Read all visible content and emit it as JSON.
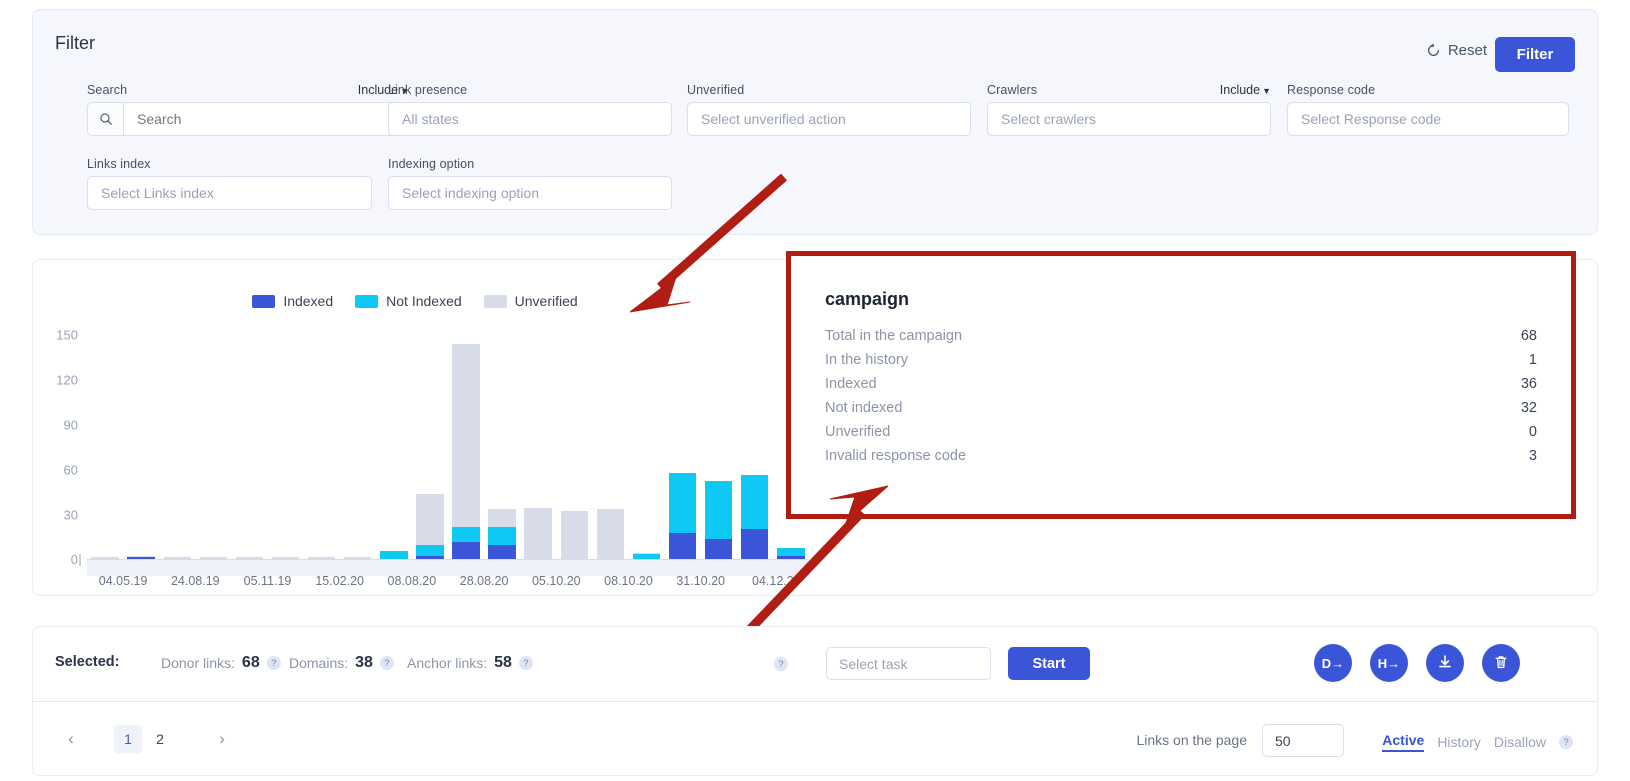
{
  "filter": {
    "title": "Filter",
    "reset_label": "Reset",
    "filter_label": "Filter",
    "accent": "#3b55d9",
    "fields": [
      {
        "label": "Search",
        "include": "Include",
        "placeholder": "Search",
        "type": "search"
      },
      {
        "label": "Link presence",
        "include": "",
        "placeholder": "All states",
        "type": "select"
      },
      {
        "label": "Unverified",
        "include": "",
        "placeholder": "Select unverified action",
        "type": "select"
      },
      {
        "label": "Crawlers",
        "include": "Include",
        "placeholder": "Select crawlers",
        "type": "select"
      },
      {
        "label": "Response code",
        "include": "",
        "placeholder": "Select Response code",
        "type": "select"
      },
      {
        "label": "Links index",
        "include": "",
        "placeholder": "Select Links index",
        "type": "select"
      },
      {
        "label": "Indexing option",
        "include": "",
        "placeholder": "Select indexing option",
        "type": "select"
      }
    ]
  },
  "chart_data": {
    "type": "bar",
    "stacked": true,
    "title": "",
    "xlabel": "",
    "ylabel": "",
    "ylim": [
      0,
      150
    ],
    "yticks": [
      150,
      120,
      90,
      60,
      30,
      0
    ],
    "grid": false,
    "legend_position": "top-center",
    "colors": {
      "Indexed": "#3b55d9",
      "Not Indexed": "#0fc9f4",
      "Unverified": "#d7dce8"
    },
    "legend": [
      "Indexed",
      "Not Indexed",
      "Unverified"
    ],
    "categories": [
      "04.05.19",
      "",
      "24.08.19",
      "",
      "05.11.19",
      "",
      "15.02.20",
      "",
      "08.08.20",
      "",
      "28.08.20",
      "",
      "05.10.20",
      "",
      "08.10.20",
      "",
      "31.10.20",
      "",
      "04.12.2",
      ""
    ],
    "xtick_labels": [
      "04.05.19",
      "24.08.19",
      "05.11.19",
      "15.02.20",
      "08.08.20",
      "28.08.20",
      "05.10.20",
      "08.10.20",
      "31.10.20",
      "04.12.2"
    ],
    "series": [
      {
        "name": "Indexed",
        "values": [
          1,
          2,
          1,
          1,
          1,
          1,
          1,
          1,
          0,
          3,
          12,
          10,
          1,
          1,
          1,
          1,
          18,
          14,
          21,
          3
        ]
      },
      {
        "name": "Not Indexed",
        "values": [
          0,
          0,
          0,
          0,
          0,
          0,
          0,
          0,
          6,
          7,
          10,
          12,
          0,
          0,
          0,
          3,
          40,
          39,
          36,
          5
        ]
      },
      {
        "name": "Unverified",
        "values": [
          1,
          1,
          1,
          1,
          1,
          1,
          1,
          1,
          0,
          34,
          122,
          12,
          34,
          32,
          33,
          1,
          0,
          0,
          0,
          0
        ]
      }
    ]
  },
  "campaign": {
    "title": "campaign",
    "rows": [
      {
        "label": "Total in the campaign",
        "value": "68"
      },
      {
        "label": "In the history",
        "value": "1"
      },
      {
        "label": "Indexed",
        "value": "36"
      },
      {
        "label": "Not indexed",
        "value": "32"
      },
      {
        "label": "Unverified",
        "value": "0"
      },
      {
        "label": "Invalid response code",
        "value": "3"
      }
    ],
    "highlight_color": "#b01d12"
  },
  "toolbar": {
    "selected_label": "Selected:",
    "stats": [
      {
        "key": "Donor links:",
        "value": "68"
      },
      {
        "key": "Domains:",
        "value": "38"
      },
      {
        "key": "Anchor links:",
        "value": "58"
      }
    ],
    "help_glyph": "?",
    "task_placeholder": "Select task",
    "start_label": "Start",
    "round_buttons": [
      {
        "name": "donor-export-button",
        "glyph": "D→"
      },
      {
        "name": "host-export-button",
        "glyph": "H→"
      },
      {
        "name": "download-button",
        "glyph": "↓"
      },
      {
        "name": "delete-button",
        "glyph": "🗑"
      }
    ]
  },
  "pager": {
    "prev": "‹",
    "next": "›",
    "pages": [
      {
        "label": "1",
        "active": true
      },
      {
        "label": "2",
        "active": false
      }
    ],
    "links_on_page_label": "Links on the page",
    "per_page": "50",
    "tabs": [
      {
        "label": "Active",
        "active": true
      },
      {
        "label": "History",
        "active": false
      },
      {
        "label": "Disallow",
        "active": false
      }
    ],
    "help_glyph": "?"
  }
}
